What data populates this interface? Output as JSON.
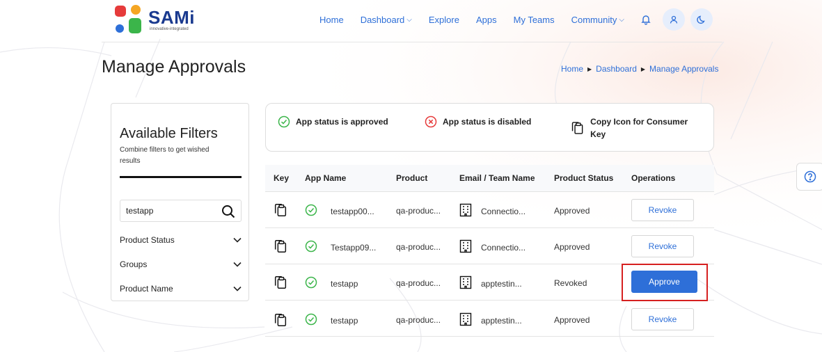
{
  "brand": {
    "name": "SAMi",
    "tagline": "innovative-integrated",
    "colors": {
      "orange": "#f26b2b",
      "red": "#e63b3b",
      "blue": "#2e6fd8",
      "green": "#3bb54a",
      "navy": "#1a3a8f"
    }
  },
  "nav": {
    "items": [
      {
        "label": "Home",
        "dropdown": false
      },
      {
        "label": "Dashboard",
        "dropdown": true
      },
      {
        "label": "Explore",
        "dropdown": false
      },
      {
        "label": "Apps",
        "dropdown": false
      },
      {
        "label": "My Teams",
        "dropdown": false
      },
      {
        "label": "Community",
        "dropdown": true
      }
    ],
    "icons": [
      "bell-icon",
      "user-icon",
      "moon-icon"
    ]
  },
  "page": {
    "title": "Manage Approvals",
    "breadcrumb": [
      "Home",
      "Dashboard",
      "Manage Approvals"
    ]
  },
  "filters": {
    "title": "Available Filters",
    "subtitle": "Combine filters to get wished results",
    "search_value": "testapp",
    "groups": [
      "Product Status",
      "Groups",
      "Product Name"
    ]
  },
  "legend": {
    "approved": "App status is approved",
    "disabled": "App status is disabled",
    "copy": "Copy Icon for Consumer Key"
  },
  "table": {
    "headers": [
      "Key",
      "App Name",
      "Product",
      "Email / Team Name",
      "Product Status",
      "Operations"
    ],
    "rows": [
      {
        "app": "testapp00...",
        "product": "qa-produc...",
        "team": "Connectio...",
        "status": "Approved",
        "action": "Revoke"
      },
      {
        "app": "Testapp09...",
        "product": "qa-produc...",
        "team": "Connectio...",
        "status": "Approved",
        "action": "Revoke"
      },
      {
        "app": "testapp",
        "product": "qa-produc...",
        "team": "apptestin...",
        "status": "Revoked",
        "action": "Approve"
      },
      {
        "app": "testapp",
        "product": "qa-produc...",
        "team": "apptestin...",
        "status": "Approved",
        "action": "Revoke"
      }
    ]
  }
}
